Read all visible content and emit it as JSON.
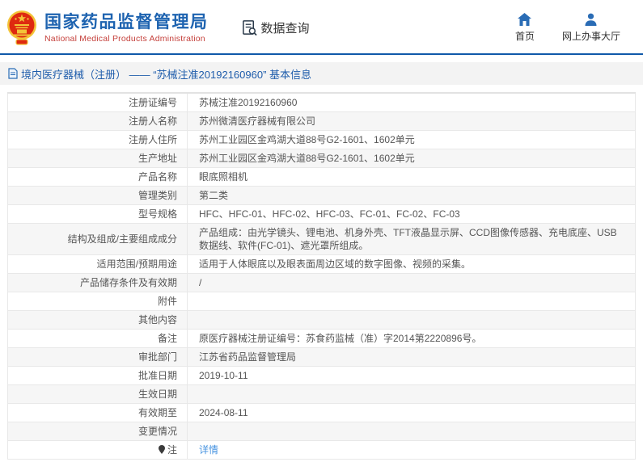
{
  "header": {
    "brand": {
      "name_zh": "国家药品监督管理局",
      "name_en": "National Medical Products Administration"
    },
    "menu": {
      "data_query": "数据查询"
    },
    "nav": {
      "home": "首页",
      "service_hall": "网上办事大厅"
    }
  },
  "title_bar": {
    "text": "境内医疗器械（注册） —— “苏械注准20192160960” 基本信息"
  },
  "table": {
    "rows": [
      {
        "label": "注册证编号",
        "value": "苏械注准20192160960"
      },
      {
        "label": "注册人名称",
        "value": "苏州微清医疗器械有限公司"
      },
      {
        "label": "注册人住所",
        "value": "苏州工业园区金鸡湖大道88号G2-1601、1602单元"
      },
      {
        "label": "生产地址",
        "value": "苏州工业园区金鸡湖大道88号G2-1601、1602单元"
      },
      {
        "label": "产品名称",
        "value": "眼底照相机"
      },
      {
        "label": "管理类别",
        "value": "第二类"
      },
      {
        "label": "型号规格",
        "value": "HFC、HFC-01、HFC-02、HFC-03、FC-01、FC-02、FC-03"
      },
      {
        "label": "结构及组成/主要组成成分",
        "value": "产品组成：由光学镜头、锂电池、机身外壳、TFT液晶显示屏、CCD图像传感器、充电底座、USB数据线、软件(FC-01)、遮光罩所组成。"
      },
      {
        "label": "适用范围/预期用途",
        "value": "适用于人体眼底以及眼表面周边区域的数字图像、视频的采集。"
      },
      {
        "label": "产品储存条件及有效期",
        "value": "/"
      },
      {
        "label": "附件",
        "value": ""
      },
      {
        "label": "其他内容",
        "value": ""
      },
      {
        "label": "备注",
        "value": "原医疗器械注册证编号：苏食药监械（准）字2014第2220896号。"
      },
      {
        "label": "审批部门",
        "value": "江苏省药品监督管理局"
      },
      {
        "label": "批准日期",
        "value": "2019-10-11"
      },
      {
        "label": "生效日期",
        "value": ""
      },
      {
        "label": "有效期至",
        "value": "2024-08-11"
      },
      {
        "label": "变更情况",
        "value": ""
      },
      {
        "label": "注",
        "label_icon": "note-pin-icon",
        "value": "详情",
        "link": true
      }
    ]
  },
  "colors": {
    "brand_blue": "#1e63b0",
    "brand_red": "#c5413c",
    "header_line_blue": "#1059a9",
    "title_bar_bg": "#f3f3f3",
    "link_blue": "#4693e0",
    "zebra_gray": "#f6f6f6",
    "emblem_red": "#de2910",
    "emblem_gold": "#f3c338"
  }
}
